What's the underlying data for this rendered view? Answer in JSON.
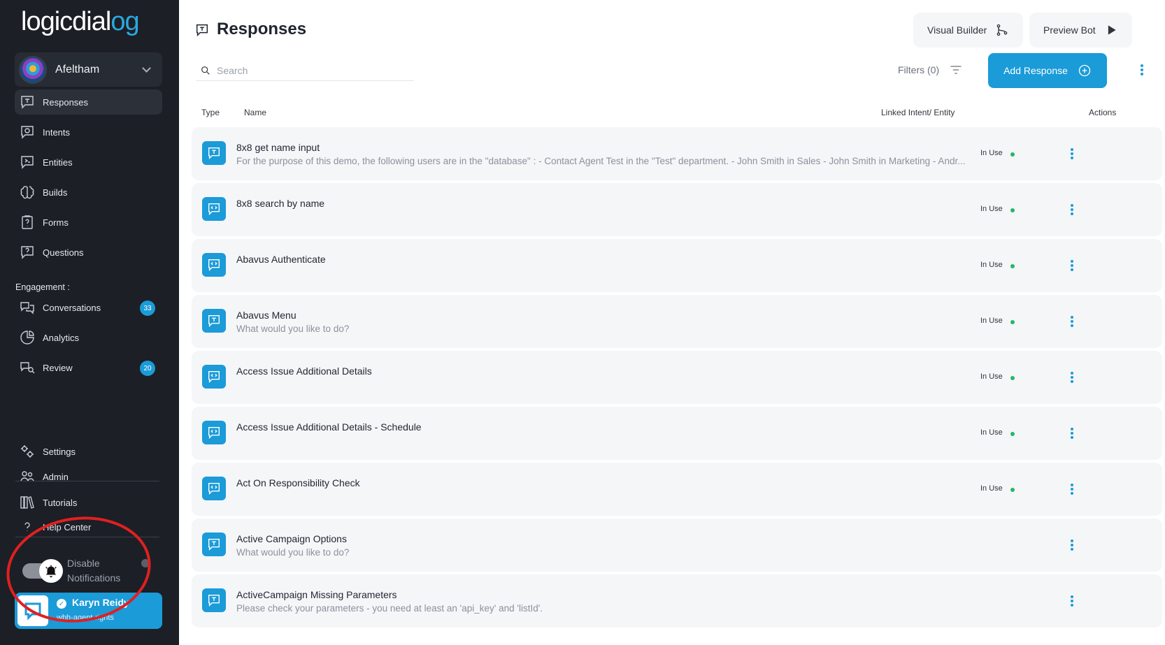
{
  "brand": {
    "logo_text": "logicdial",
    "logo_accent": "og",
    "accent_color": "#1b9bd8"
  },
  "workspace": {
    "name": "Afeltham"
  },
  "nav": {
    "items": [
      {
        "label": "Responses"
      },
      {
        "label": "Intents"
      },
      {
        "label": "Entities"
      },
      {
        "label": "Builds"
      },
      {
        "label": "Forms"
      },
      {
        "label": "Questions"
      }
    ],
    "engagement_label": "Engagement :",
    "engagement": [
      {
        "label": "Conversations",
        "badge": "33"
      },
      {
        "label": "Analytics"
      },
      {
        "label": "Review",
        "badge": "20"
      }
    ],
    "bottom": [
      {
        "label": "Settings"
      },
      {
        "label": "Admin"
      },
      {
        "label": "Tutorials"
      },
      {
        "label": "Help Center"
      }
    ],
    "notifications_label": "Disable Notifications"
  },
  "user": {
    "name": "Karyn Reidy",
    "subtitle": "wbh-agent-rights"
  },
  "header": {
    "title": "Responses",
    "visual_builder_label": "Visual Builder",
    "preview_bot_label": "Preview Bot",
    "search_placeholder": "Search",
    "filters_label": "Filters (0)",
    "add_response_label": "Add Response"
  },
  "table": {
    "columns": {
      "type": "Type",
      "name": "Name",
      "linked": "Linked Intent/ Entity",
      "actions": "Actions"
    },
    "rows": [
      {
        "type": "text",
        "name": "8x8 get name input",
        "desc": "For the purpose of this demo, the following users are in the \"database\" : - Contact Agent Test in the \"Test\" department. - John Smith in Sales - John Smith in Marketing - Andr...",
        "status": "In Use"
      },
      {
        "type": "code",
        "name": "8x8 search by name",
        "desc": "",
        "status": "In Use"
      },
      {
        "type": "code",
        "name": "Abavus Authenticate",
        "desc": "",
        "status": "In Use"
      },
      {
        "type": "text",
        "name": "Abavus Menu",
        "desc": "What would you like to do?",
        "status": "In Use"
      },
      {
        "type": "code",
        "name": "Access Issue Additional Details",
        "desc": "",
        "status": "In Use"
      },
      {
        "type": "code",
        "name": "Access Issue Additional Details - Schedule",
        "desc": "",
        "status": "In Use"
      },
      {
        "type": "code",
        "name": "Act On Responsibility Check",
        "desc": "",
        "status": "In Use"
      },
      {
        "type": "text",
        "name": "Active Campaign Options",
        "desc": "What would you like to do?",
        "status": ""
      },
      {
        "type": "text",
        "name": "ActiveCampaign Missing Parameters",
        "desc": "Please check your parameters - you need at least an 'api_key' and 'listId'.",
        "status": ""
      }
    ]
  }
}
